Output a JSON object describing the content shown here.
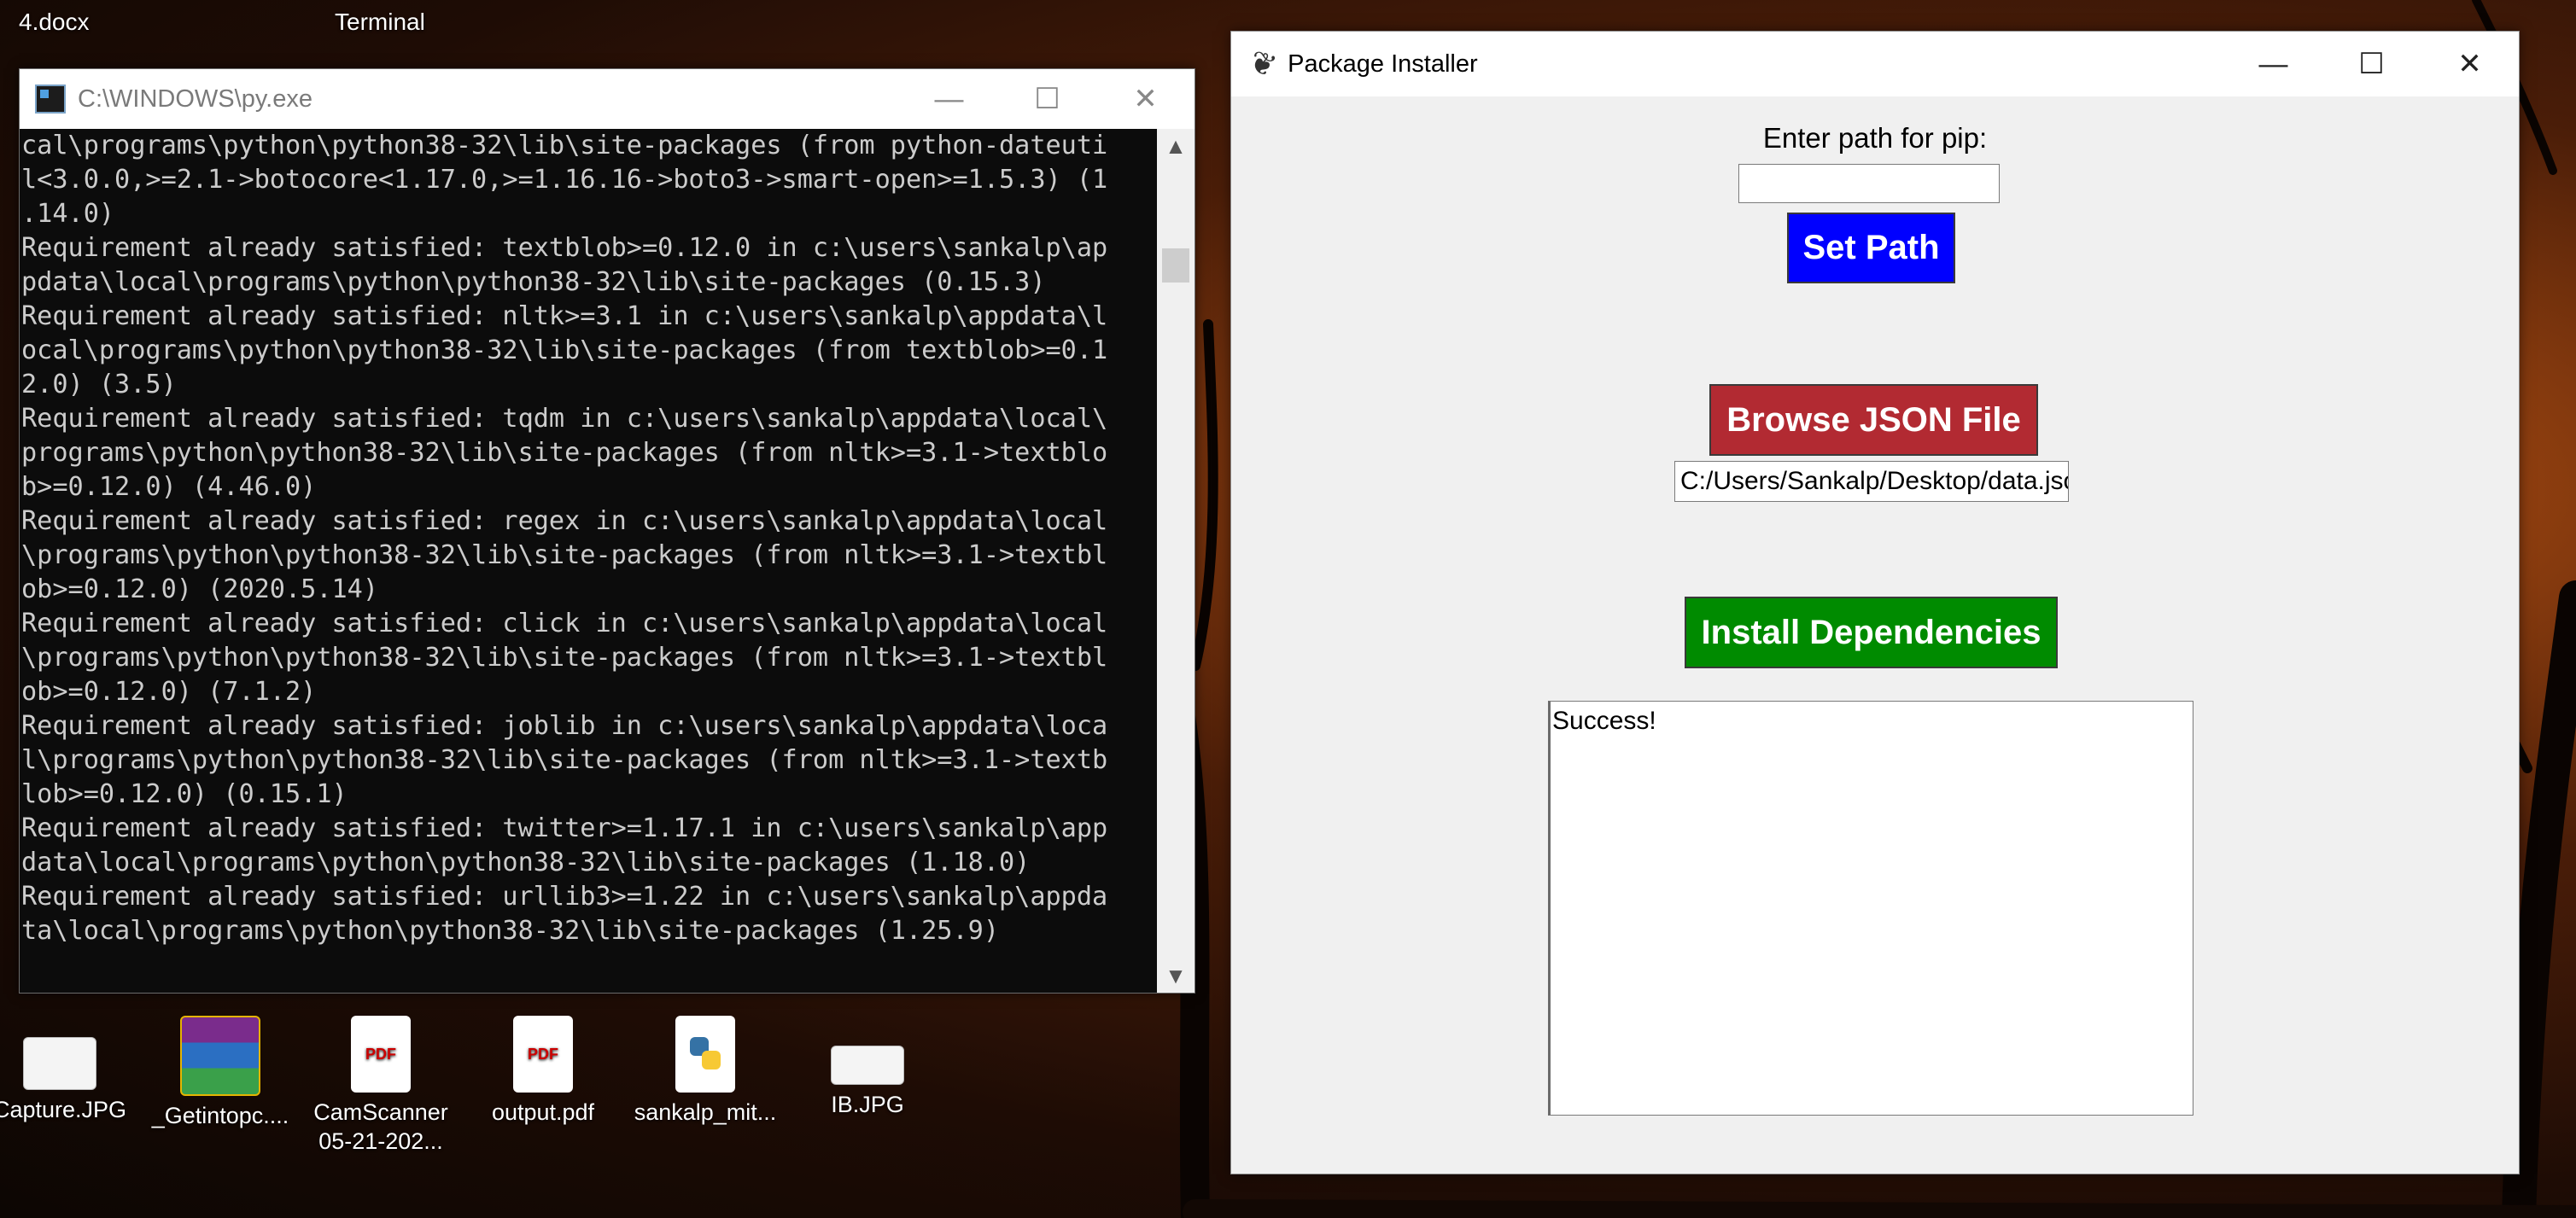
{
  "desktop": {
    "top_labels": [
      "4.docx",
      "Terminal"
    ],
    "icons": [
      {
        "label": "Capture.JPG",
        "icon": "image-icon"
      },
      {
        "label": "_Getintopc....",
        "icon": "winrar-icon"
      },
      {
        "label": "CamScanner 05-21-202...",
        "icon": "pdf-icon"
      },
      {
        "label": "output.pdf",
        "icon": "pdf-icon"
      },
      {
        "label": "sankalp_mit...",
        "icon": "python-file-icon"
      },
      {
        "label": "IB.JPG",
        "icon": "image-icon"
      }
    ]
  },
  "console": {
    "title": "C:\\WINDOWS\\py.exe",
    "lines": [
      "cal\\programs\\python\\python38-32\\lib\\site-packages (from python-dateuti",
      "l<3.0.0,>=2.1->botocore<1.17.0,>=1.16.16->boto3->smart-open>=1.5.3) (1",
      ".14.0)",
      "Requirement already satisfied: textblob>=0.12.0 in c:\\users\\sankalp\\ap",
      "pdata\\local\\programs\\python\\python38-32\\lib\\site-packages (0.15.3)",
      "Requirement already satisfied: nltk>=3.1 in c:\\users\\sankalp\\appdata\\l",
      "ocal\\programs\\python\\python38-32\\lib\\site-packages (from textblob>=0.1",
      "2.0) (3.5)",
      "Requirement already satisfied: tqdm in c:\\users\\sankalp\\appdata\\local\\",
      "programs\\python\\python38-32\\lib\\site-packages (from nltk>=3.1->textblo",
      "b>=0.12.0) (4.46.0)",
      "Requirement already satisfied: regex in c:\\users\\sankalp\\appdata\\local",
      "\\programs\\python\\python38-32\\lib\\site-packages (from nltk>=3.1->textbl",
      "ob>=0.12.0) (2020.5.14)",
      "Requirement already satisfied: click in c:\\users\\sankalp\\appdata\\local",
      "\\programs\\python\\python38-32\\lib\\site-packages (from nltk>=3.1->textbl",
      "ob>=0.12.0) (7.1.2)",
      "Requirement already satisfied: joblib in c:\\users\\sankalp\\appdata\\loca",
      "l\\programs\\python\\python38-32\\lib\\site-packages (from nltk>=3.1->textb",
      "lob>=0.12.0) (0.15.1)",
      "Requirement already satisfied: twitter>=1.17.1 in c:\\users\\sankalp\\app",
      "data\\local\\programs\\python\\python38-32\\lib\\site-packages (1.18.0)",
      "Requirement already satisfied: urllib3>=1.22 in c:\\users\\sankalp\\appda",
      "ta\\local\\programs\\python\\python38-32\\lib\\site-packages (1.25.9)"
    ]
  },
  "installer": {
    "title": "Package Installer",
    "pip_label": "Enter path for pip:",
    "pip_value": "",
    "set_path_label": "Set Path",
    "browse_label": "Browse JSON File",
    "json_path": "C:/Users/Sankalp/Desktop/data.jso",
    "install_label": "Install Dependencies",
    "output_text": "Success!",
    "colors": {
      "set_path": "#0000ff",
      "browse": "#b22a32",
      "install": "#008b00"
    }
  },
  "window_controls": {
    "minimize": "—",
    "maximize": "☐",
    "close": "✕"
  }
}
